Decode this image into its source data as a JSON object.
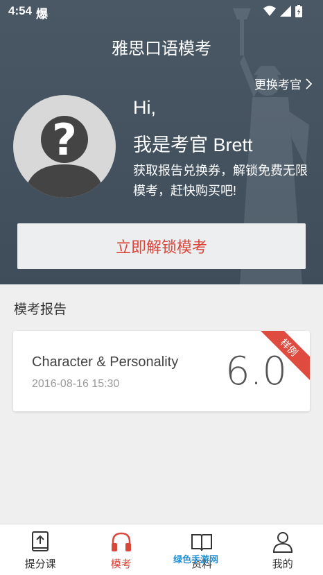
{
  "status": {
    "time": "4:54",
    "notif": "爆"
  },
  "header": {
    "title": "雅思口语模考",
    "change_examiner": "更换考官"
  },
  "examiner": {
    "hi": "Hi,",
    "intro": "我是考官 Brett",
    "desc": "获取报告兑换券，解锁免费无限模考，赶快购买吧!"
  },
  "unlock_button": "立即解锁模考",
  "reports": {
    "section_title": "模考报告",
    "items": [
      {
        "title": "Character & Personality",
        "date": "2016-08-16 15:30",
        "score": "6.0",
        "badge": "样例"
      }
    ]
  },
  "tabs": [
    {
      "label": "提分课",
      "icon": "book-up-icon"
    },
    {
      "label": "模考",
      "icon": "headphones-icon",
      "active": true
    },
    {
      "label": "资料",
      "icon": "open-book-icon"
    },
    {
      "label": "我的",
      "icon": "person-icon"
    }
  ],
  "watermark": "绿色手游网",
  "colors": {
    "accent": "#d9463a",
    "hero_bg": "#45525f"
  }
}
